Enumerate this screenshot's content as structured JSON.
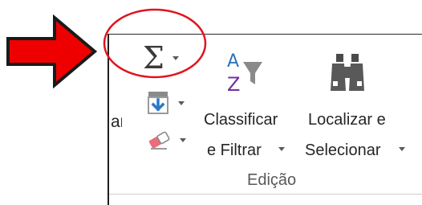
{
  "ribbon": {
    "cut_left_label": "ar",
    "group_label": "Edição",
    "autosum": {
      "icon": "sigma-icon",
      "symbol": "Σ"
    },
    "fill": {
      "icon": "fill-down-icon"
    },
    "clear": {
      "icon": "eraser-icon"
    },
    "sort_filter": {
      "icon": "sort-az-filter-icon",
      "line1": "Classificar",
      "line2": "e Filtrar"
    },
    "find_select": {
      "icon": "binoculars-icon",
      "line1": "Localizar e",
      "line2": "Selecionar"
    }
  },
  "annotations": {
    "arrow_color": "#ee0000",
    "circle_color": "#e0141e"
  }
}
